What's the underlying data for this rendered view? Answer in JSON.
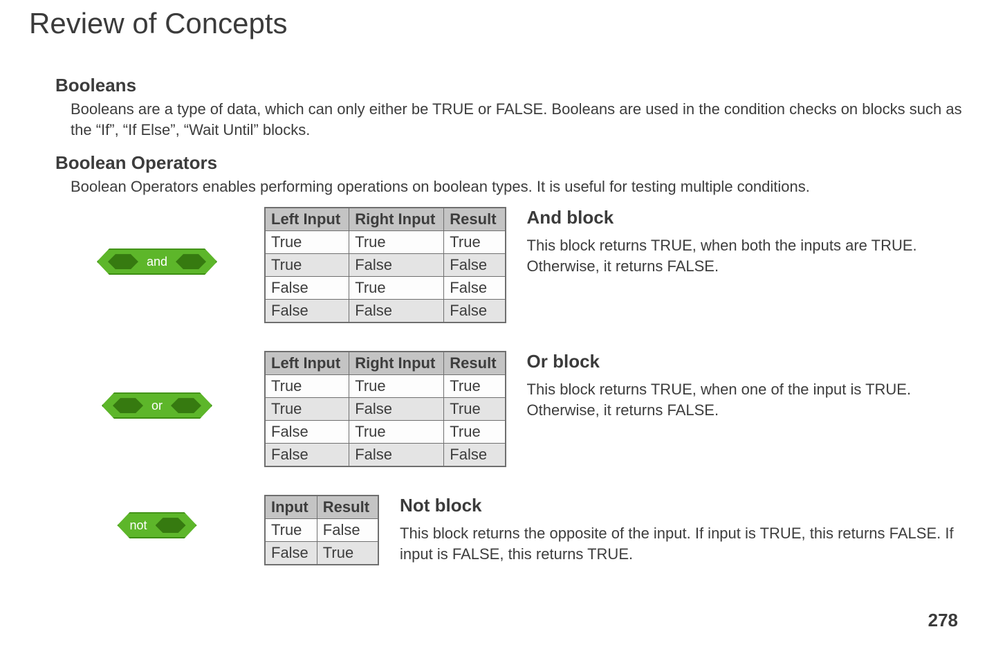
{
  "page": {
    "title": "Review of Concepts",
    "number": "278"
  },
  "booleans": {
    "heading": "Booleans",
    "body": "Booleans are a type of data, which can only either be TRUE or FALSE. Booleans are used in the condition checks on blocks such as the “If”, “If Else”, “Wait Until” blocks."
  },
  "operators": {
    "heading": "Boolean Operators",
    "body": "Boolean Operators enables performing operations on boolean types. It is useful for testing multiple conditions."
  },
  "and": {
    "block_label": "and",
    "title": "And block",
    "desc": "This block returns TRUE, when both the inputs are TRUE. Otherwise, it returns FALSE.",
    "headers": [
      "Left Input",
      "Right Input",
      "Result"
    ],
    "rows": [
      [
        "True",
        "True",
        "True"
      ],
      [
        "True",
        "False",
        "False"
      ],
      [
        "False",
        "True",
        "False"
      ],
      [
        "False",
        "False",
        "False"
      ]
    ]
  },
  "or": {
    "block_label": "or",
    "title": "Or block",
    "desc": "This block returns TRUE, when one of the input is TRUE. Otherwise, it returns FALSE.",
    "headers": [
      "Left Input",
      "Right Input",
      "Result"
    ],
    "rows": [
      [
        "True",
        "True",
        "True"
      ],
      [
        "True",
        "False",
        "True"
      ],
      [
        "False",
        "True",
        "True"
      ],
      [
        "False",
        "False",
        "False"
      ]
    ]
  },
  "not": {
    "block_label": "not",
    "title": "Not block",
    "desc": "This block returns the opposite of the input. If input is TRUE, this returns FALSE. If input is FALSE, this returns TRUE.",
    "headers": [
      "Input",
      "Result"
    ],
    "rows": [
      [
        "True",
        "False"
      ],
      [
        "False",
        "True"
      ]
    ]
  }
}
